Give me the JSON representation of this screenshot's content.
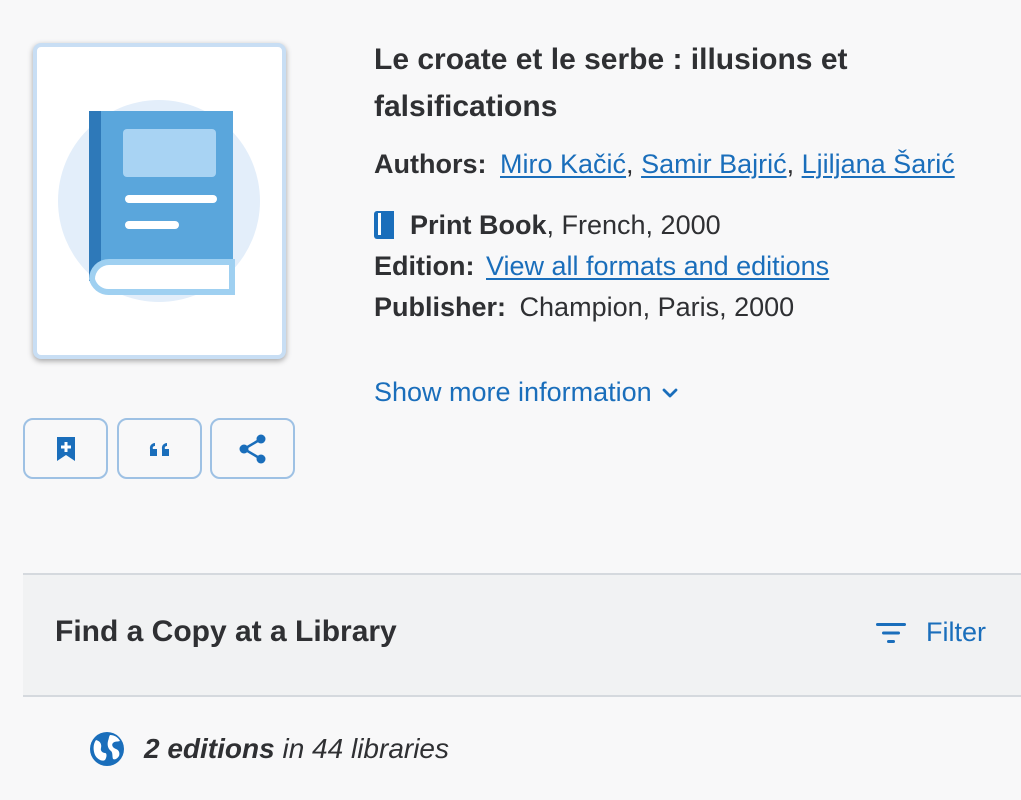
{
  "record": {
    "title": "Le croate et le serbe : illusions et falsifications",
    "authors_label": "Authors:",
    "authors": [
      "Miro Kačić",
      "Samir Bajrić",
      "Ljiljana Šarić"
    ],
    "format": "Print Book",
    "format_details": ", French, 2000",
    "edition_label": "Edition:",
    "edition_link": "View all formats and editions",
    "publisher_label": "Publisher:",
    "publisher": "Champion, Paris, 2000",
    "show_more": "Show more information"
  },
  "actions": {
    "save_icon": "bookmark-plus-icon",
    "cite_icon": "quote-icon",
    "share_icon": "share-icon"
  },
  "find_copy": {
    "title": "Find a Copy at a Library",
    "filter_label": "Filter"
  },
  "holdings": {
    "editions": "2 editions",
    "libraries": " in 44 libraries"
  },
  "colors": {
    "accent": "#1a6ebb",
    "text": "#2f3033",
    "panel": "#f1f2f3"
  }
}
